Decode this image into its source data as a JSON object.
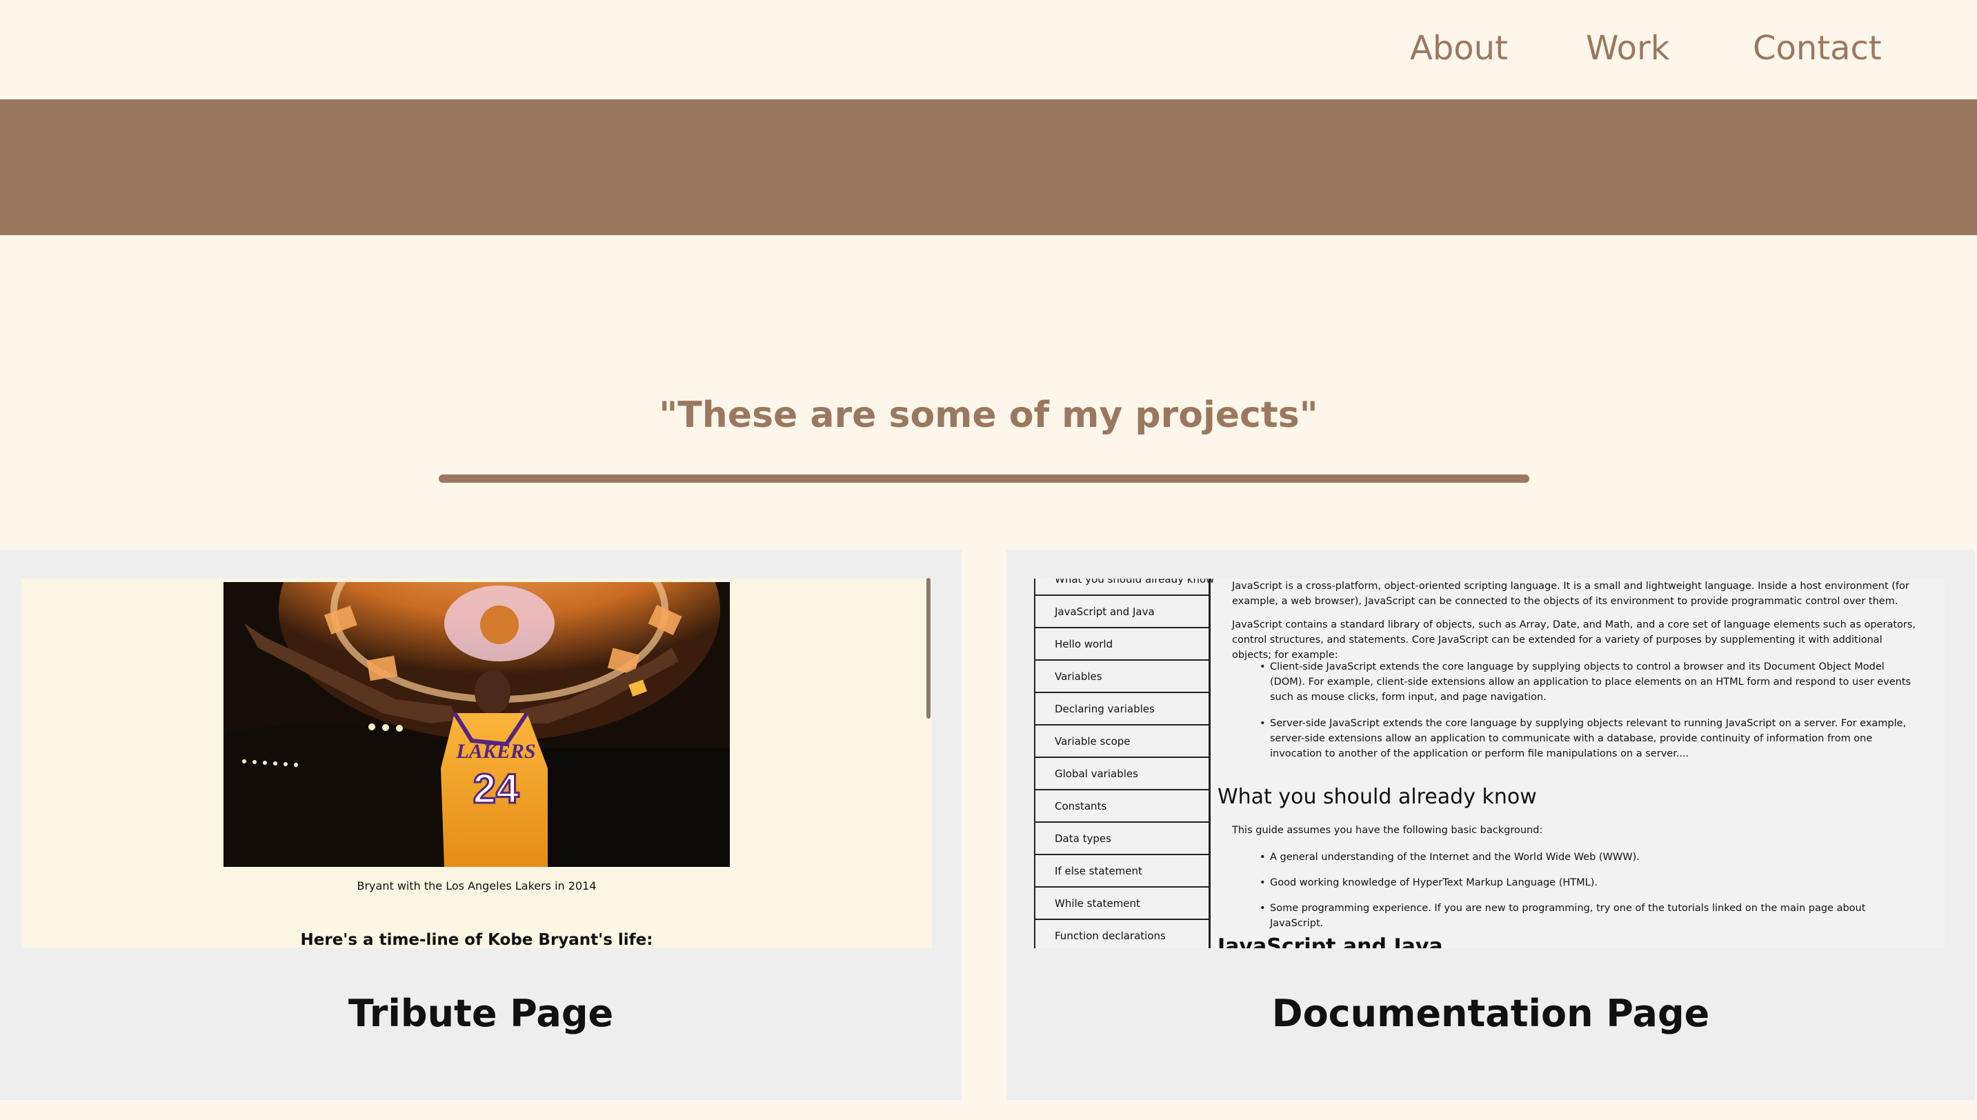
{
  "nav": {
    "about": "About",
    "work": "Work",
    "contact": "Contact"
  },
  "projects_section": {
    "title": "\"These are some of my projects\""
  },
  "projects": [
    {
      "label": "Tribute Page",
      "preview": {
        "caption": "Bryant with the Los Angeles Lakers in 2014",
        "timeline_heading": "Here's a time-line of Kobe Bryant's life:",
        "jersey_team": "LAKERS",
        "jersey_number": "24"
      }
    },
    {
      "label": "Documentation Page",
      "preview": {
        "nav_items": [
          "What you should already know",
          "JavaScript and Java",
          "Hello world",
          "Variables",
          "Declaring variables",
          "Variable scope",
          "Global variables",
          "Constants",
          "Data types",
          "If else statement",
          "While statement",
          "Function declarations"
        ],
        "intro_p1": "JavaScript is a cross-platform, object-oriented scripting language. It is a small and lightweight language. Inside a host environment (for example, a web browser), JavaScript can be connected to the objects of its environment to provide programmatic control over them.",
        "intro_p2": "JavaScript contains a standard library of objects, such as Array, Date, and Math, and a core set of language elements such as operators, control structures, and statements. Core JavaScript can be extended for a variety of purposes by supplementing it with additional objects; for example:",
        "bullet_client": "Client-side JavaScript extends the core language by supplying objects to control a browser and its Document Object Model (DOM). For example, client-side extensions allow an application to place elements on an HTML form and respond to user events such as mouse clicks, form input, and page navigation.",
        "bullet_server": "Server-side JavaScript extends the core language by supplying objects relevant to running JavaScript on a server. For example, server-side extensions allow an application to communicate with a database, provide continuity of information from one invocation to another of the application or perform file manipulations on a server....",
        "h2_know": "What you should already know",
        "know_p": "This guide assumes you have the following basic background:",
        "know_items": [
          "A general understanding of the Internet and the World Wide Web (WWW).",
          "Good working knowledge of HyperText Markup Language (HTML).",
          "Some programming experience. If you are new to programming, try one of the tutorials linked on the main page about JavaScript."
        ],
        "h2_next": "JavaScript and Java"
      }
    }
  ],
  "colors": {
    "background": "#fdf6ea",
    "accent_brown": "#9a7860",
    "card_gray": "#eeeeee"
  }
}
